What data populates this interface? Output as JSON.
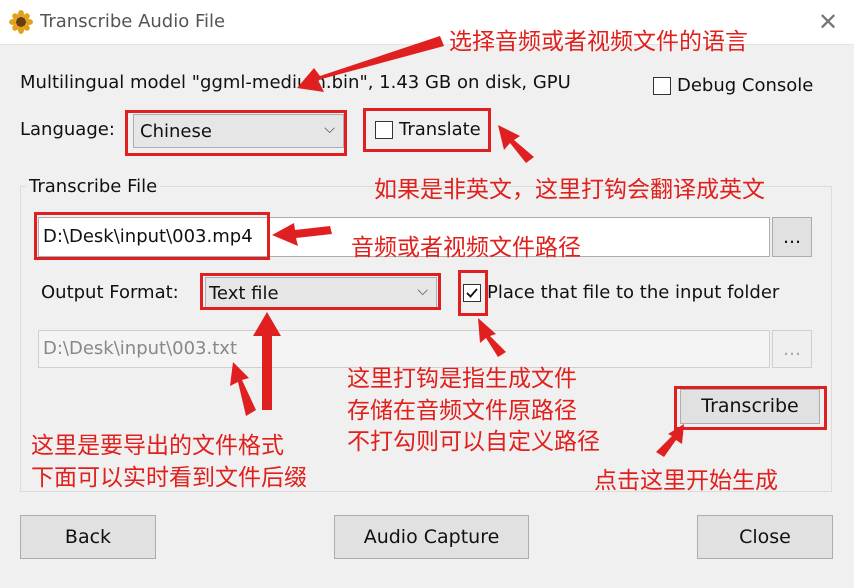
{
  "window": {
    "title": "Transcribe Audio File"
  },
  "model_info": "Multilingual model \"ggml-medium.bin\", 1.43 GB on disk, GPU",
  "debug_console": {
    "label": "Debug Console",
    "checked": false
  },
  "language": {
    "label": "Language:",
    "selected": "Chinese"
  },
  "translate": {
    "label": "Translate",
    "checked": false
  },
  "transcribe_file": {
    "group_label": "Transcribe File",
    "input_path": "D:\\Desk\\input\\003.mp4",
    "browse_label": "..."
  },
  "output": {
    "format_label": "Output Format:",
    "format_selected": "Text file",
    "place_label": "Place that file to the input folder",
    "place_checked": true,
    "output_path": "D:\\Desk\\input\\003.txt",
    "browse_label": "..."
  },
  "buttons": {
    "transcribe": "Transcribe",
    "back": "Back",
    "audio_capture": "Audio Capture",
    "close": "Close"
  },
  "annotations": {
    "language_note": "选择音频或者视频文件的语言",
    "translate_note": "如果是非英文，这里打钩会翻译成英文",
    "path_note": "音频或者视频文件路径",
    "place_note_1": "这里打钩是指生成文件",
    "place_note_2": "存储在音频文件原路径",
    "place_note_3": "不打勾则可以自定义路径",
    "format_note_1": "这里是要导出的文件格式",
    "format_note_2": "下面可以实时看到文件后缀",
    "transcribe_note": "点击这里开始生成"
  },
  "colors": {
    "annotation": "#e02020",
    "check_color": "#111111"
  }
}
